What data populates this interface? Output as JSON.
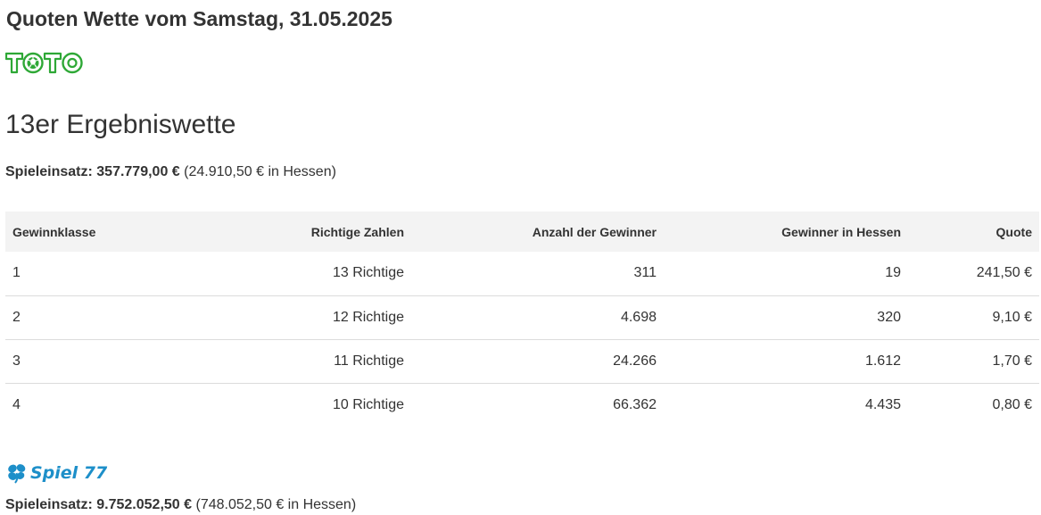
{
  "page_title": "Quoten Wette vom Samstag, 31.05.2025",
  "toto_logo": {
    "text": "TOTO",
    "icon": "soccer-ball-icon",
    "color": "#2ea836"
  },
  "section_title": "13er Ergebniswette",
  "stake_toto": {
    "label": "Spieleinsatz:",
    "amount": "357.779,00 €",
    "hessen": "(24.910,50 € in Hessen)"
  },
  "table": {
    "headers": [
      "Gewinnklasse",
      "Richtige Zahlen",
      "Anzahl der Gewinner",
      "Gewinner in Hessen",
      "Quote"
    ],
    "rows": [
      [
        "1",
        "13 Richtige",
        "311",
        "19",
        "241,50 €"
      ],
      [
        "2",
        "12 Richtige",
        "4.698",
        "320",
        "9,10 €"
      ],
      [
        "3",
        "11 Richtige",
        "24.266",
        "1.612",
        "1,70 €"
      ],
      [
        "4",
        "10 Richtige",
        "66.362",
        "4.435",
        "0,80 €"
      ]
    ]
  },
  "spiel77_logo": {
    "text": "Spiel 77",
    "icon": "clover-icon",
    "color": "#1d8fc9"
  },
  "stake_spiel77": {
    "label": "Spieleinsatz:",
    "amount": "9.752.052,50 €",
    "hessen": "(748.052,50 € in Hessen)"
  }
}
